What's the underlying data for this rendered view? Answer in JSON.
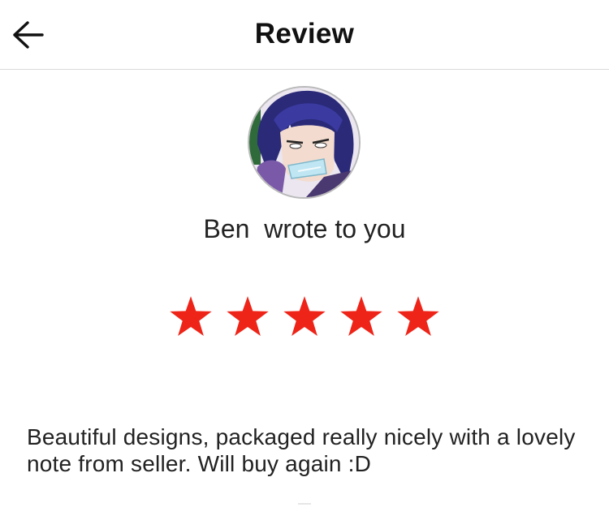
{
  "header": {
    "title": "Review",
    "back_icon": "arrow-left-icon"
  },
  "reviewer": {
    "name": "Ben",
    "action_text": "wrote to you",
    "avatar_icon": "anime-character-avatar"
  },
  "rating": {
    "value": 5,
    "max": 5,
    "star_color": "#ee2418"
  },
  "review": {
    "text": "Beautiful designs, packaged really nicely with a lovely note from seller. Will buy again :D"
  }
}
